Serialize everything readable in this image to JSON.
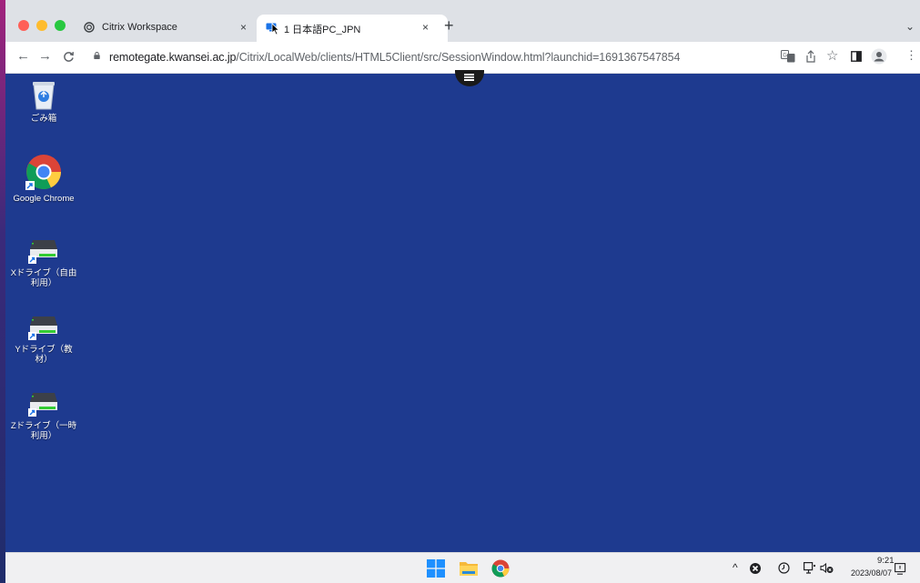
{
  "browser": {
    "tabs": [
      {
        "title": "Citrix Workspace",
        "close": "×",
        "icon": "citrix-icon"
      },
      {
        "title": "1 日本語PC_JPN",
        "close": "×",
        "icon": "monitor-icon"
      }
    ],
    "new_tab": "+",
    "tab_menu": "⌄",
    "url_host": "remotegate.kwansei.ac.jp",
    "url_path": "/Citrix/LocalWeb/clients/HTML5Client/src/SessionWindow.html?launchid=1691367547854"
  },
  "desktop": {
    "background": "#1e3a8f",
    "icons": [
      {
        "label": "ごみ箱",
        "icon": "recycle-bin-icon"
      },
      {
        "label": "Google Chrome",
        "icon": "chrome-icon"
      },
      {
        "label": "Xドライブ（自由利用）",
        "icon": "network-drive-icon"
      },
      {
        "label": "Yドライブ（教材）",
        "icon": "network-drive-icon"
      },
      {
        "label": "Zドライブ（一時利用）",
        "icon": "network-drive-icon"
      }
    ]
  },
  "taskbar": {
    "apps": [
      "windows-start-icon",
      "file-explorer-icon",
      "chrome-icon"
    ],
    "tray": {
      "time": "9:21",
      "date": "2023/08/07"
    }
  }
}
